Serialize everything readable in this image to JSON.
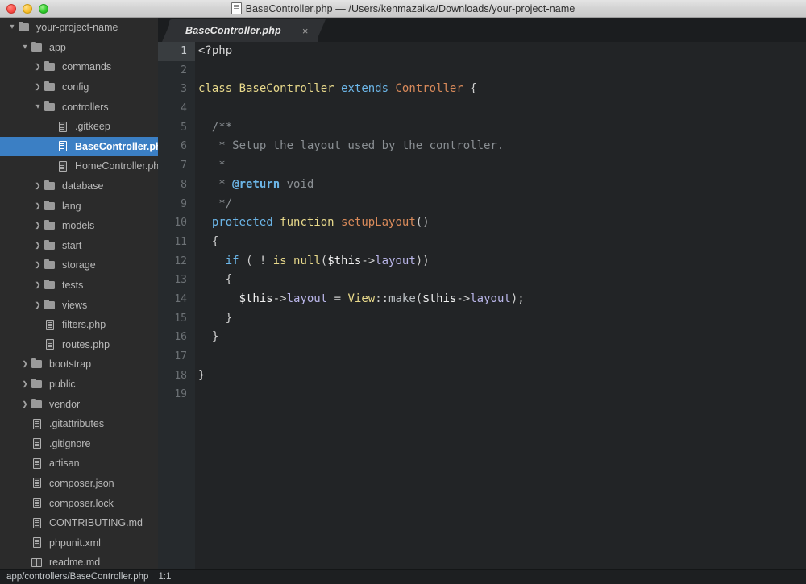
{
  "window": {
    "title": "BaseController.php — /Users/kenmazaika/Downloads/your-project-name",
    "doc_icon": "document-icon",
    "controls": {
      "close": "close-window-button",
      "minimize": "minimize-window-button",
      "zoom": "zoom-window-button"
    },
    "colors": {
      "close": "#fa4b45",
      "minimize": "#f9bf2e",
      "zoom": "#2fcb2b",
      "titlebar_bg": "#d3d3d3",
      "sidebar_bg": "#2b2b2b",
      "editor_bg": "#222426",
      "gutter_bg": "#262a2d",
      "selection_blue": "#3b7fc4",
      "statusbar_bg": "#1d1f21"
    }
  },
  "sidebar": {
    "items": [
      {
        "label": "your-project-name",
        "type": "folder",
        "depth": 0,
        "state": "expanded",
        "selected": false
      },
      {
        "label": "app",
        "type": "folder",
        "depth": 1,
        "state": "expanded",
        "selected": false
      },
      {
        "label": "commands",
        "type": "folder",
        "depth": 2,
        "state": "collapsed",
        "selected": false
      },
      {
        "label": "config",
        "type": "folder",
        "depth": 2,
        "state": "collapsed",
        "selected": false
      },
      {
        "label": "controllers",
        "type": "folder",
        "depth": 2,
        "state": "expanded",
        "selected": false
      },
      {
        "label": ".gitkeep",
        "type": "file",
        "depth": 3,
        "state": "leaf",
        "selected": false
      },
      {
        "label": "BaseController.php",
        "type": "file",
        "depth": 3,
        "state": "leaf",
        "selected": true
      },
      {
        "label": "HomeController.php",
        "type": "file",
        "depth": 3,
        "state": "leaf",
        "selected": false
      },
      {
        "label": "database",
        "type": "folder",
        "depth": 2,
        "state": "collapsed",
        "selected": false
      },
      {
        "label": "lang",
        "type": "folder",
        "depth": 2,
        "state": "collapsed",
        "selected": false
      },
      {
        "label": "models",
        "type": "folder",
        "depth": 2,
        "state": "collapsed",
        "selected": false
      },
      {
        "label": "start",
        "type": "folder",
        "depth": 2,
        "state": "collapsed",
        "selected": false
      },
      {
        "label": "storage",
        "type": "folder",
        "depth": 2,
        "state": "collapsed",
        "selected": false
      },
      {
        "label": "tests",
        "type": "folder",
        "depth": 2,
        "state": "collapsed",
        "selected": false
      },
      {
        "label": "views",
        "type": "folder",
        "depth": 2,
        "state": "collapsed",
        "selected": false
      },
      {
        "label": "filters.php",
        "type": "file",
        "depth": 2,
        "state": "leaf",
        "selected": false
      },
      {
        "label": "routes.php",
        "type": "file",
        "depth": 2,
        "state": "leaf",
        "selected": false
      },
      {
        "label": "bootstrap",
        "type": "folder",
        "depth": 1,
        "state": "collapsed",
        "selected": false
      },
      {
        "label": "public",
        "type": "folder",
        "depth": 1,
        "state": "collapsed",
        "selected": false
      },
      {
        "label": "vendor",
        "type": "folder",
        "depth": 1,
        "state": "collapsed",
        "selected": false
      },
      {
        "label": ".gitattributes",
        "type": "file",
        "depth": 1,
        "state": "leaf",
        "selected": false
      },
      {
        "label": ".gitignore",
        "type": "file",
        "depth": 1,
        "state": "leaf",
        "selected": false
      },
      {
        "label": "artisan",
        "type": "file",
        "depth": 1,
        "state": "leaf",
        "selected": false
      },
      {
        "label": "composer.json",
        "type": "file",
        "depth": 1,
        "state": "leaf",
        "selected": false
      },
      {
        "label": "composer.lock",
        "type": "file",
        "depth": 1,
        "state": "leaf",
        "selected": false
      },
      {
        "label": "CONTRIBUTING.md",
        "type": "file",
        "depth": 1,
        "state": "leaf",
        "selected": false
      },
      {
        "label": "phpunit.xml",
        "type": "file",
        "depth": 1,
        "state": "leaf",
        "selected": false
      },
      {
        "label": "readme.md",
        "type": "book",
        "depth": 1,
        "state": "leaf",
        "selected": false
      }
    ]
  },
  "tabs": [
    {
      "label": "BaseController.php",
      "close_label": "×",
      "active": true
    }
  ],
  "editor": {
    "line_numbers": [
      1,
      2,
      3,
      4,
      5,
      6,
      7,
      8,
      9,
      10,
      11,
      12,
      13,
      14,
      15,
      16,
      17,
      18,
      19
    ],
    "active_line": 1,
    "lines": [
      {
        "n": 1,
        "tokens": [
          {
            "t": "<?php",
            "c": "t-plain"
          }
        ]
      },
      {
        "n": 2,
        "tokens": []
      },
      {
        "n": 3,
        "tokens": [
          {
            "t": "class ",
            "c": "t-kw2"
          },
          {
            "t": "BaseController",
            "c": "t-class"
          },
          {
            "t": " ",
            "c": "t-plain"
          },
          {
            "t": "extends",
            "c": "t-kw"
          },
          {
            "t": " ",
            "c": "t-plain"
          },
          {
            "t": "Controller",
            "c": "t-type"
          },
          {
            "t": " {",
            "c": "t-punct"
          }
        ]
      },
      {
        "n": 4,
        "tokens": []
      },
      {
        "n": 5,
        "tokens": [
          {
            "t": "  /**",
            "c": "t-cmt"
          }
        ]
      },
      {
        "n": 6,
        "tokens": [
          {
            "t": "   * Setup the layout used by the controller.",
            "c": "t-cmt"
          }
        ]
      },
      {
        "n": 7,
        "tokens": [
          {
            "t": "   *",
            "c": "t-cmt"
          }
        ]
      },
      {
        "n": 8,
        "tokens": [
          {
            "t": "   * ",
            "c": "t-cmt"
          },
          {
            "t": "@return",
            "c": "t-doc"
          },
          {
            "t": " void",
            "c": "t-cmt"
          }
        ]
      },
      {
        "n": 9,
        "tokens": [
          {
            "t": "   */",
            "c": "t-cmt"
          }
        ]
      },
      {
        "n": 10,
        "tokens": [
          {
            "t": "  ",
            "c": "t-plain"
          },
          {
            "t": "protected",
            "c": "t-kw"
          },
          {
            "t": " ",
            "c": "t-plain"
          },
          {
            "t": "function",
            "c": "t-kw2"
          },
          {
            "t": " ",
            "c": "t-plain"
          },
          {
            "t": "setupLayout",
            "c": "t-type"
          },
          {
            "t": "()",
            "c": "t-punct"
          }
        ]
      },
      {
        "n": 11,
        "tokens": [
          {
            "t": "  {",
            "c": "t-punct"
          }
        ]
      },
      {
        "n": 12,
        "tokens": [
          {
            "t": "    ",
            "c": "t-plain"
          },
          {
            "t": "if",
            "c": "t-kw"
          },
          {
            "t": " ( ",
            "c": "t-punct"
          },
          {
            "t": "!",
            "c": "t-op"
          },
          {
            "t": " ",
            "c": "t-plain"
          },
          {
            "t": "is_null",
            "c": "t-kw2"
          },
          {
            "t": "(",
            "c": "t-punct"
          },
          {
            "t": "$this",
            "c": "t-var"
          },
          {
            "t": "->",
            "c": "t-punct"
          },
          {
            "t": "layout",
            "c": "t-prop"
          },
          {
            "t": "))",
            "c": "t-punct"
          }
        ]
      },
      {
        "n": 13,
        "tokens": [
          {
            "t": "    {",
            "c": "t-punct"
          }
        ]
      },
      {
        "n": 14,
        "tokens": [
          {
            "t": "      ",
            "c": "t-plain"
          },
          {
            "t": "$this",
            "c": "t-var"
          },
          {
            "t": "->",
            "c": "t-punct"
          },
          {
            "t": "layout",
            "c": "t-prop"
          },
          {
            "t": " ",
            "c": "t-plain"
          },
          {
            "t": "=",
            "c": "t-op"
          },
          {
            "t": " ",
            "c": "t-plain"
          },
          {
            "t": "View",
            "c": "t-kw2"
          },
          {
            "t": "::",
            "c": "t-punct"
          },
          {
            "t": "make",
            "c": "t-fn"
          },
          {
            "t": "(",
            "c": "t-punct"
          },
          {
            "t": "$this",
            "c": "t-var"
          },
          {
            "t": "->",
            "c": "t-punct"
          },
          {
            "t": "layout",
            "c": "t-prop"
          },
          {
            "t": ");",
            "c": "t-punct"
          }
        ]
      },
      {
        "n": 15,
        "tokens": [
          {
            "t": "    }",
            "c": "t-punct"
          }
        ]
      },
      {
        "n": 16,
        "tokens": [
          {
            "t": "  }",
            "c": "t-punct"
          }
        ]
      },
      {
        "n": 17,
        "tokens": []
      },
      {
        "n": 18,
        "tokens": [
          {
            "t": "}",
            "c": "t-punct"
          }
        ]
      },
      {
        "n": 19,
        "tokens": []
      }
    ]
  },
  "statusbar": {
    "path": "app/controllers/BaseController.php",
    "cursor": "1:1"
  }
}
